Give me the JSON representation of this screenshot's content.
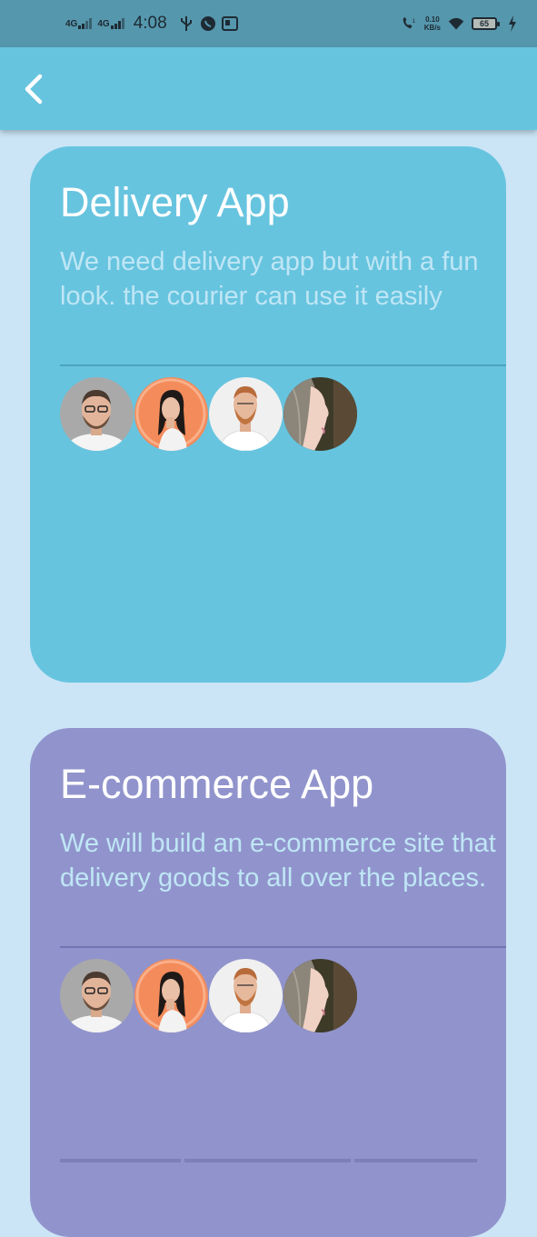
{
  "status_bar": {
    "network_1": "4G",
    "network_2": "4G",
    "time": "4:08",
    "speed_value": "0.10",
    "speed_unit": "KB/s",
    "battery": "65"
  },
  "app_bar": {
    "back_icon": "chevron-left-icon"
  },
  "cards": [
    {
      "title": "Delivery App",
      "description": "We need delivery app but with a fun look.  the courier can use it easily",
      "background": "#67c4df",
      "avatars": [
        "man-with-glasses",
        "woman-orange-background",
        "bearded-man-white-shirt",
        "woman-profile-closeup"
      ]
    },
    {
      "title": "E-commerce App",
      "description": "We will build an e-commerce site that delivery goods to all over the places.",
      "background": "#9194cc",
      "avatars": [
        "man-with-glasses",
        "woman-orange-background",
        "bearded-man-white-shirt",
        "woman-profile-closeup"
      ]
    }
  ],
  "colors": {
    "page_background": "#cbe5f6",
    "status_bar": "#5597ad",
    "app_bar": "#67c4df"
  }
}
